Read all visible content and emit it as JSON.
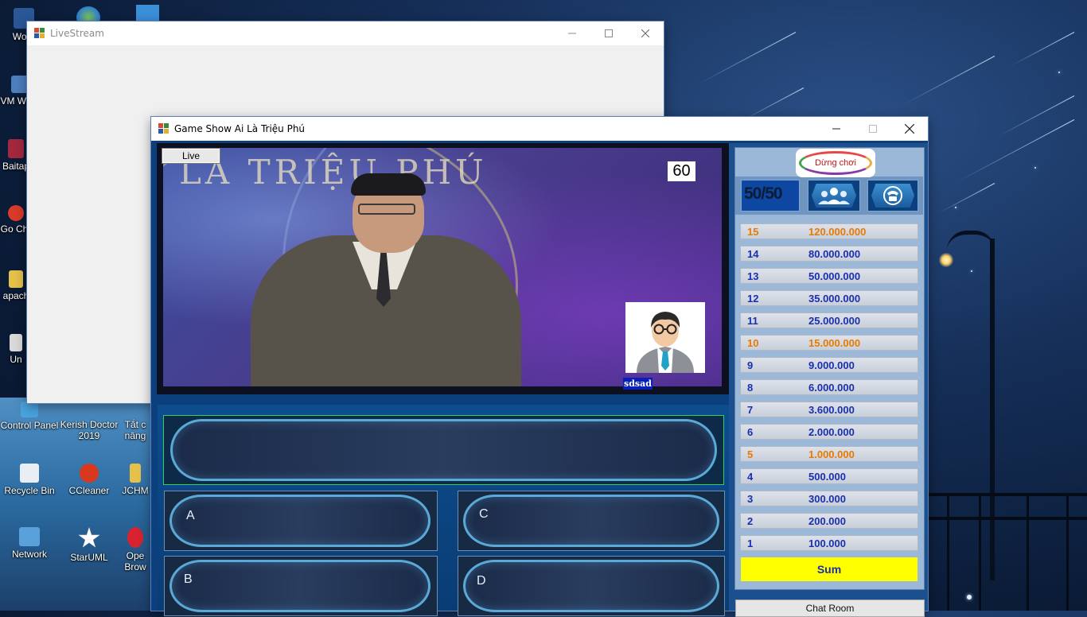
{
  "desktop": {
    "icons": [
      {
        "label": "Word",
        "icon": "word-icon"
      },
      {
        "label": "VM Work",
        "icon": "vmware-icon"
      },
      {
        "label": "Baitap",
        "icon": "winrar-icon"
      },
      {
        "label": "Go Chr",
        "icon": "chrome-icon"
      },
      {
        "label": "apach",
        "icon": "folder-icon"
      },
      {
        "label": "Un",
        "icon": "uninstall-icon"
      },
      {
        "label": "Control Panel",
        "icon": "control-panel-icon"
      },
      {
        "label": "Kerish Doctor 2019",
        "icon": "kerish-doctor-icon"
      },
      {
        "label": "Tắt c nâng",
        "icon": "shortcut-icon"
      },
      {
        "label": "Recycle Bin",
        "icon": "recycle-bin-icon"
      },
      {
        "label": "CCleaner",
        "icon": "ccleaner-icon"
      },
      {
        "label": "JCHM",
        "icon": "folder-icon"
      },
      {
        "label": "Network",
        "icon": "network-icon"
      },
      {
        "label": "StarUML",
        "icon": "staruml-icon"
      },
      {
        "label": "Ope Brow",
        "icon": "opera-icon"
      }
    ]
  },
  "livestream_window": {
    "title": "LiveStream",
    "controls": {
      "minimize": "minimize-icon",
      "maximize": "maximize-icon",
      "close": "close-icon"
    }
  },
  "game_window": {
    "title": "Game Show Ai Là Triệu Phú",
    "controls": {
      "minimize": "minimize-icon",
      "maximize": "maximize-icon",
      "close": "close-icon"
    },
    "video": {
      "live_button": "Live",
      "backdrop_text": "LÀ TRIỆU PHÚ",
      "timer": "60",
      "player_name": "sdsad"
    },
    "question": {
      "text": ""
    },
    "answers": [
      {
        "letter": "A",
        "text": ""
      },
      {
        "letter": "B",
        "text": ""
      },
      {
        "letter": "C",
        "text": ""
      },
      {
        "letter": "D",
        "text": ""
      }
    ],
    "right_panel": {
      "stop_button": "Dừng chơi",
      "lifelines": [
        {
          "label": "50/50",
          "icon": "fifty-fifty-icon"
        },
        {
          "label": "",
          "icon": "ask-audience-icon"
        },
        {
          "label": "",
          "icon": "phone-friend-icon"
        }
      ],
      "prizes": [
        {
          "level": "15",
          "amount": "120.000.000",
          "milestone": true
        },
        {
          "level": "14",
          "amount": "80.000.000",
          "milestone": false
        },
        {
          "level": "13",
          "amount": "50.000.000",
          "milestone": false
        },
        {
          "level": "12",
          "amount": "35.000.000",
          "milestone": false
        },
        {
          "level": "11",
          "amount": "25.000.000",
          "milestone": false
        },
        {
          "level": "10",
          "amount": "15.000.000",
          "milestone": true
        },
        {
          "level": "9",
          "amount": "9.000.000",
          "milestone": false
        },
        {
          "level": "8",
          "amount": "6.000.000",
          "milestone": false
        },
        {
          "level": "7",
          "amount": "3.600.000",
          "milestone": false
        },
        {
          "level": "6",
          "amount": "2.000.000",
          "milestone": false
        },
        {
          "level": "5",
          "amount": "1.000.000",
          "milestone": true
        },
        {
          "level": "4",
          "amount": "500.000",
          "milestone": false
        },
        {
          "level": "3",
          "amount": "300.000",
          "milestone": false
        },
        {
          "level": "2",
          "amount": "200.000",
          "milestone": false
        },
        {
          "level": "1",
          "amount": "100.000",
          "milestone": false
        }
      ],
      "sum_button": "Sum",
      "chat_button": "Chat Room"
    },
    "colors": {
      "milestone": "#e87a00",
      "normal": "#1a2fb0",
      "sum_bg": "#ffff00",
      "stop_text": "#c01818"
    }
  }
}
